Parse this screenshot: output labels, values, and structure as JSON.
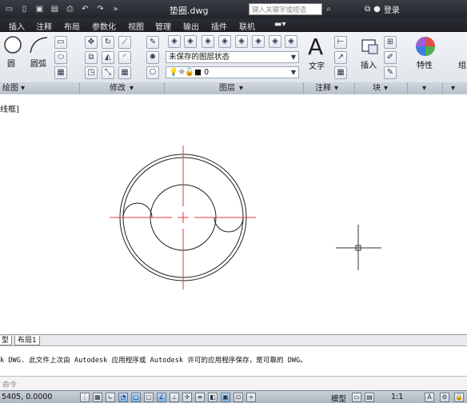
{
  "titlebar": {
    "title": "垫圈.dwg",
    "search_placeholder": "键入关键字或短语",
    "login": "登录",
    "quick_access_icons": [
      "app-menu-icon",
      "new-icon",
      "save-icon",
      "save-as-icon",
      "print-icon",
      "undo-icon",
      "redo-icon",
      "more-icon"
    ]
  },
  "menu": {
    "items": [
      "插入",
      "注释",
      "布局",
      "参数化",
      "视图",
      "管理",
      "输出",
      "插件",
      "联机"
    ]
  },
  "ribbon": {
    "panels": {
      "draw": "绘图",
      "modify": "修改",
      "layer": "图层",
      "annotate": "注释",
      "block": "块"
    },
    "draw_buttons": {
      "circle": "圆",
      "arc": "圆弧"
    },
    "layer_state": "未保存的图层状态",
    "layer_current": "0",
    "text_button": "文字",
    "insert_button": "插入",
    "properties_button": "特性",
    "group_button": "组",
    "text_icon_glyph": "A"
  },
  "viewport": {
    "label": "线框]"
  },
  "layout_tabs": [
    "型",
    "布局1"
  ],
  "command": {
    "history": "k DWG.   此文件上次由 Autodesk 应用程序或 Autodesk 许可的应用程序保存，是可靠的 DWG。",
    "prompt": "命令"
  },
  "status": {
    "coords": "5405, 0.0000",
    "model": "模型",
    "scale": "1:1"
  },
  "colors": {
    "centerline": "#e23b3b",
    "geometry": "#222222",
    "titlebar": "#2b2e34"
  }
}
